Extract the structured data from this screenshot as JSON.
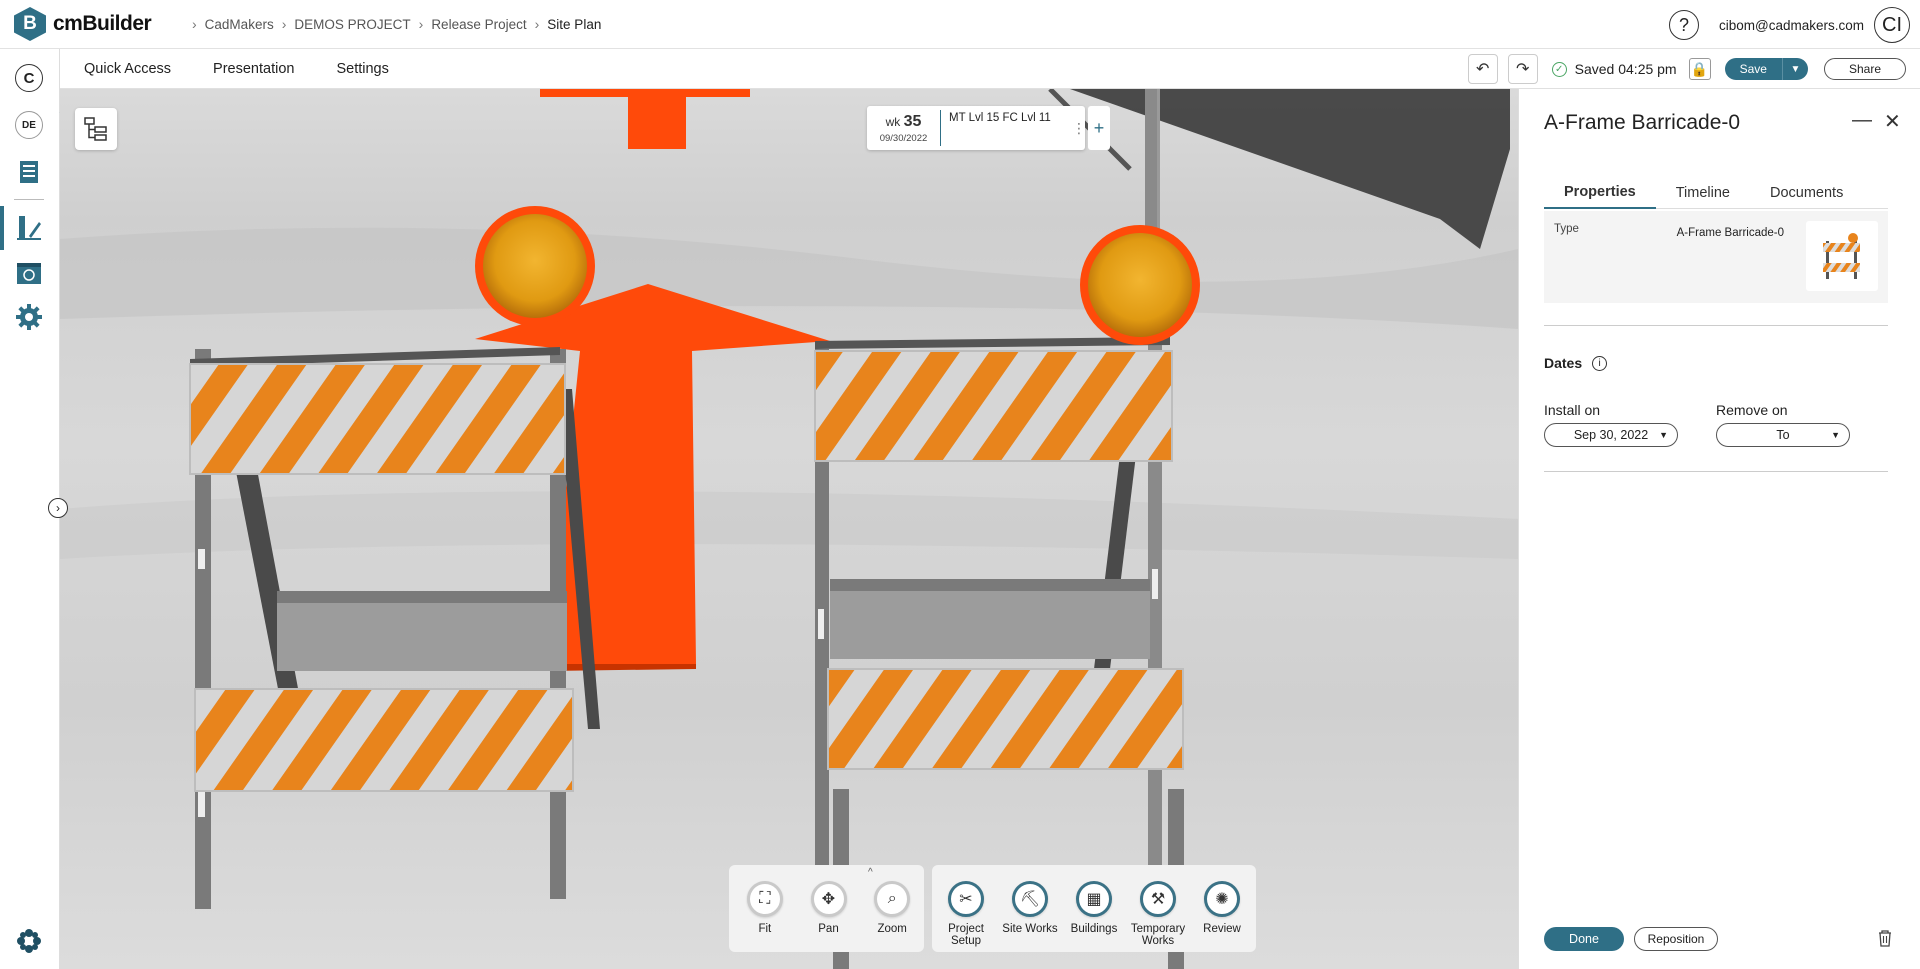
{
  "app": {
    "name": "cmBuilder",
    "logo_letter": "B"
  },
  "breadcrumb": [
    "CadMakers",
    "DEMOS PROJECT",
    "Release Project",
    "Site Plan"
  ],
  "user": {
    "email": "cibom@cadmakers.com",
    "initials": "CI",
    "help": "?"
  },
  "left_rail": {
    "c_label": "C",
    "de_label": "DE"
  },
  "menu": {
    "items": [
      "Quick Access",
      "Presentation",
      "Settings"
    ]
  },
  "status": {
    "saved_text": "Saved 04:25 pm",
    "save_label": "Save",
    "share_label": "Share"
  },
  "week_card": {
    "wk_prefix": "wk",
    "week_number": "35",
    "date": "09/30/2022",
    "label": "MT Lvl 15 FC Lvl 11",
    "add": "+"
  },
  "nav_tools": [
    {
      "label": "Fit",
      "icon": "fit-icon"
    },
    {
      "label": "Pan",
      "icon": "pan-icon"
    },
    {
      "label": "Zoom",
      "icon": "zoom-icon"
    }
  ],
  "main_tools": [
    {
      "label": "Project Setup",
      "icon": "tools-icon"
    },
    {
      "label": "Site Works",
      "icon": "excavator-icon"
    },
    {
      "label": "Buildings",
      "icon": "buildings-icon"
    },
    {
      "label": "Temporary Works",
      "icon": "crane-icon"
    },
    {
      "label": "Review",
      "icon": "review-icon"
    }
  ],
  "panel": {
    "title": "A-Frame Barricade-0",
    "tabs": [
      "Properties",
      "Timeline",
      "Documents"
    ],
    "active_tab": "Properties",
    "type_label": "Type",
    "type_value": "A-Frame Barricade-0",
    "dates_title": "Dates",
    "install_label": "Install on",
    "install_value": "Sep 30, 2022",
    "remove_label": "Remove on",
    "remove_value": "To",
    "done_label": "Done",
    "reposition_label": "Reposition"
  },
  "colors": {
    "brand": "#2f6f86",
    "barricade_orange": "#e8841c",
    "arrow_orange": "#ff4a0a",
    "saved_green": "#4aa564"
  }
}
